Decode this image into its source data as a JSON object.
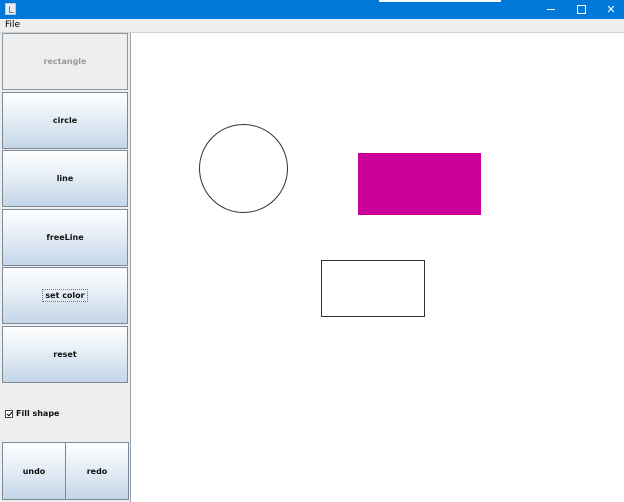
{
  "window": {
    "minimize_glyph": "",
    "maximize_glyph": "",
    "close_glyph": "✕"
  },
  "menu": {
    "file": "File"
  },
  "tools": {
    "rectangle": "rectangle",
    "circle": "circle",
    "line": "line",
    "freeline": "freeLine",
    "set_color": "set color",
    "reset": "reset",
    "active_tool": "rectangle"
  },
  "options": {
    "fill_shape_label": "Fill shape",
    "fill_shape_checked": true
  },
  "history": {
    "undo": "undo",
    "redo": "redo"
  },
  "canvas": {
    "shapes": [
      {
        "type": "circle",
        "filled": false,
        "stroke": "#333333"
      },
      {
        "type": "rectangle",
        "filled": true,
        "fill": "#cc0099"
      },
      {
        "type": "rectangle",
        "filled": false,
        "stroke": "#333333"
      }
    ]
  },
  "colors": {
    "titlebar": "#0078d7",
    "panel": "#eeeeee",
    "fill_color": "#cc0099"
  }
}
